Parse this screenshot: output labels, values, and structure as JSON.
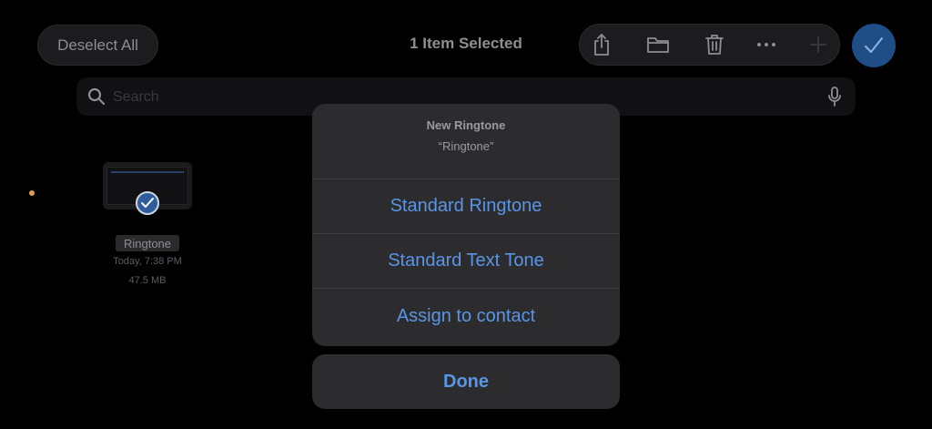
{
  "header": {
    "deselect_label": "Deselect All",
    "title": "1 Item Selected"
  },
  "toolbar": {
    "icons": [
      "share-icon",
      "folder-icon",
      "trash-icon",
      "more-icon",
      "plus-icon"
    ],
    "confirm_icon": "checkmark-icon"
  },
  "search": {
    "placeholder": "Search",
    "value": ""
  },
  "file": {
    "name": "Ringtone",
    "date": "Today, 7:38 PM",
    "size": "47.5 MB",
    "selected": true
  },
  "action_sheet": {
    "title": "New Ringtone",
    "subtitle": "“Ringtone”",
    "actions": [
      {
        "label": "Standard Ringtone"
      },
      {
        "label": "Standard Text Tone"
      },
      {
        "label": "Assign to contact"
      }
    ],
    "done_label": "Done"
  },
  "colors": {
    "accent": "#5a95e6",
    "background": "#000000",
    "sheet": "#2c2c2e"
  }
}
